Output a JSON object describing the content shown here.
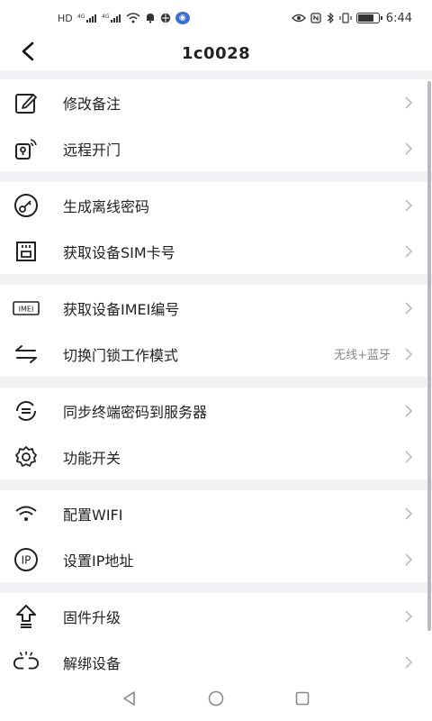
{
  "status_bar": {
    "network_labels": [
      "HD",
      "4G",
      "4G"
    ],
    "time": "6:44",
    "battery_level": 0.8
  },
  "header": {
    "title": "1c0028",
    "back_icon": "chevron-left-icon"
  },
  "menu_groups": [
    {
      "items": [
        {
          "label": "修改备注",
          "icon": "edit-icon"
        },
        {
          "label": "远程开门",
          "icon": "remote-open-icon"
        }
      ]
    },
    {
      "items": [
        {
          "label": "生成离线密码",
          "icon": "key-icon"
        },
        {
          "label": "获取设备SIM卡号",
          "icon": "sim-card-icon"
        }
      ]
    },
    {
      "items": [
        {
          "label": "获取设备IMEI编号",
          "icon": "imei-icon"
        },
        {
          "label": "切换门锁工作模式",
          "icon": "switch-arrows-icon",
          "value": "无线+蓝牙"
        }
      ]
    },
    {
      "items": [
        {
          "label": "同步终端密码到服务器",
          "icon": "sync-icon"
        },
        {
          "label": "功能开关",
          "icon": "gear-icon"
        }
      ]
    },
    {
      "items": [
        {
          "label": "配置WIFI",
          "icon": "wifi-icon"
        },
        {
          "label": "设置IP地址",
          "icon": "ip-icon",
          "icon_text": "IP"
        }
      ]
    },
    {
      "items": [
        {
          "label": "固件升级",
          "icon": "upgrade-icon"
        },
        {
          "label": "解绑设备",
          "icon": "unbind-icon"
        }
      ]
    }
  ],
  "colors": {
    "background": "#f2f2f4",
    "text": "#222222",
    "secondary_text": "#888888",
    "chevron": "#bbbbbb"
  }
}
